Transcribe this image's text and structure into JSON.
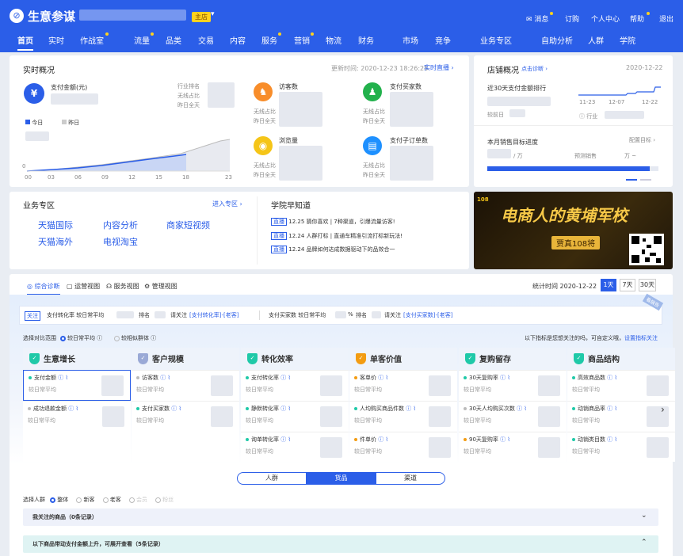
{
  "app": {
    "brand": "生意参谋",
    "shop_badge": "主店"
  },
  "top_links": [
    "消息",
    "订购",
    "个人中心",
    "帮助",
    "退出"
  ],
  "nav": [
    "首页",
    "实时",
    "作战室",
    "流量",
    "品类",
    "交易",
    "内容",
    "服务",
    "营销",
    "物流",
    "财务",
    "市场",
    "竞争",
    "业务专区",
    "自助分析",
    "人群",
    "学院"
  ],
  "realtime": {
    "title": "实时概况",
    "update_time": "更新时间: 2020-12-23 18:26:28",
    "live_link": "实时直播 ›",
    "pay_label": "支付金额(元)",
    "industry_rank": "行业排名",
    "vs_label": "无线占比",
    "yesterday_label": "昨日全天",
    "legend_today": "今日",
    "legend_yesterday": "昨日",
    "x_ticks": [
      "00",
      "03",
      "06",
      "09",
      "12",
      "15",
      "18",
      "23"
    ],
    "y0": "0",
    "metrics": [
      {
        "label": "访客数",
        "icon": "visitors-icon"
      },
      {
        "label": "支付买家数",
        "icon": "buyers-icon"
      },
      {
        "label": "浏览量",
        "icon": "eye-icon"
      },
      {
        "label": "支付子订单数",
        "icon": "order-icon"
      }
    ],
    "metric_vs": "无线占比",
    "metric_yesterday": "昨日全天"
  },
  "shop": {
    "title": "店铺概况",
    "diag": "点击诊断",
    "date": "2020-12-22",
    "rank_label": "近30天支付金额排行",
    "rank_prev": "较前日",
    "industry": "行业",
    "x_ticks": [
      "11-23",
      "12-07",
      "12-22"
    ],
    "target_title": "本月销售目标进度",
    "target_config": "配置目标 ›",
    "sales_unit": "万",
    "forecast_label": "预测销售",
    "forecast_unit": "万 ~",
    "progress": 0.95
  },
  "biz": {
    "title": "业务专区",
    "enter": "进入专区 ›",
    "links": [
      "天猫国际",
      "内容分析",
      "商家短视频",
      "天猫海外",
      "电视淘宝"
    ]
  },
  "academy": {
    "title": "学院早知道",
    "tag": "直播",
    "items": [
      "12.25 猜你喜欢 | 7种渠道，引爆流量访客!",
      "12.24 人群打标 | 直通车精准引流打标新玩法!",
      "12.24 品牌如何达成数据驱动下的品效合一"
    ]
  },
  "banner": {
    "title": "电商人的黄埔军校",
    "sub": "贾真108将",
    "logo": "108"
  },
  "diag_tabs": [
    "综合诊断",
    "运营视图",
    "服务视图",
    "管理视图"
  ],
  "stat_time": "统计时间 2020-12-22",
  "period": [
    "1天",
    "7天",
    "30天"
  ],
  "alert": {
    "tag": "关注",
    "left": "支付转化率 较日常平均",
    "rank": "排名",
    "notice1": "请关注",
    "link1": "[支付转化率]-[老客]",
    "right": "支付买家数 较日常平均",
    "pct": "%",
    "link2": "[支付买家数]-[老客]",
    "corner": "看报告"
  },
  "compare": {
    "label": "选择对比范围",
    "opt1": "较日常平均",
    "opt2": "较相似群体",
    "hint": "以下指标是您想关注的吗，可自定义哦，",
    "hint_link": "设置指标关注"
  },
  "columns": [
    {
      "title": "生意增长",
      "color": "#1fc9a8",
      "cells": [
        {
          "name": "支付金额",
          "color": "#1fc9a8"
        },
        {
          "name": "成功退款金额",
          "color": "#bbbbbb"
        }
      ]
    },
    {
      "title": "客户规模",
      "color": "#9aa9d6",
      "cells": [
        {
          "name": "访客数",
          "color": "#bbbbbb"
        },
        {
          "name": "支付买家数",
          "color": "#1fc9a8"
        }
      ]
    },
    {
      "title": "转化效率",
      "color": "#1fc9a8",
      "cells": [
        {
          "name": "支付转化率",
          "color": "#1fc9a8"
        },
        {
          "name": "静默转化率",
          "color": "#1fc9a8"
        },
        {
          "name": "询单转化率",
          "color": "#1fc9a8"
        }
      ]
    },
    {
      "title": "单客价值",
      "color": "#f39c12",
      "cells": [
        {
          "name": "客单价",
          "color": "#f39c12"
        },
        {
          "name": "人均购买商品件数",
          "color": "#1fc9a8"
        },
        {
          "name": "件单价",
          "color": "#f39c12"
        }
      ]
    },
    {
      "title": "复购留存",
      "color": "#1fc9a8",
      "cells": [
        {
          "name": "30天复购率",
          "color": "#1fc9a8"
        },
        {
          "name": "30天人均购买次数",
          "color": "#bbbbbb"
        },
        {
          "name": "90天复购率",
          "color": "#f39c12"
        }
      ]
    },
    {
      "title": "商品结构",
      "color": "#1fc9a8",
      "cells": [
        {
          "name": "高效商品数",
          "color": "#1fc9a8"
        },
        {
          "name": "动销商品率",
          "color": "#1fc9a8"
        },
        {
          "name": "动销类目数",
          "color": "#1fc9a8"
        }
      ]
    }
  ],
  "cell_sub": "较日常平均",
  "seg_tabs": [
    "人群",
    "货品",
    "渠道"
  ],
  "crowd": {
    "label": "选择人群",
    "opts": [
      "整体",
      "新客",
      "老客",
      "会员",
      "粉丝"
    ]
  },
  "acc1": "我关注的商品（0条记录）",
  "acc2": "以下商品带动支付金额上升，可展开查看（5条记录）"
}
